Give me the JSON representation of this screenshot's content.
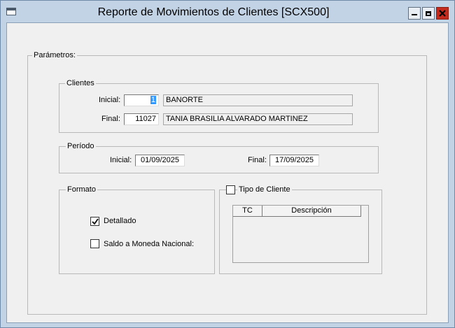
{
  "window": {
    "title": "Reporte de Movimientos de Clientes [SCX500]"
  },
  "parametros": {
    "label": "Parámetros:"
  },
  "clientes": {
    "label": "Clientes",
    "inicial_label": "Inicial:",
    "inicial_code": "1",
    "inicial_name": "BANORTE",
    "final_label": "Final:",
    "final_code": "11027",
    "final_name": "TANIA BRASILIA ALVARADO MARTINEZ"
  },
  "periodo": {
    "label": "Período",
    "inicial_label": "Inicial:",
    "inicial_value": "01/09/2025",
    "final_label": "Final:",
    "final_value": "17/09/2025"
  },
  "formato": {
    "label": "Formato",
    "detallado_label": "Detallado",
    "detallado_checked": true,
    "saldo_label": "Saldo a Moneda Nacional:",
    "saldo_checked": false
  },
  "tipo_cliente": {
    "label": "Tipo de Cliente",
    "checked": false,
    "columns": [
      "TC",
      "Descripción"
    ]
  }
}
